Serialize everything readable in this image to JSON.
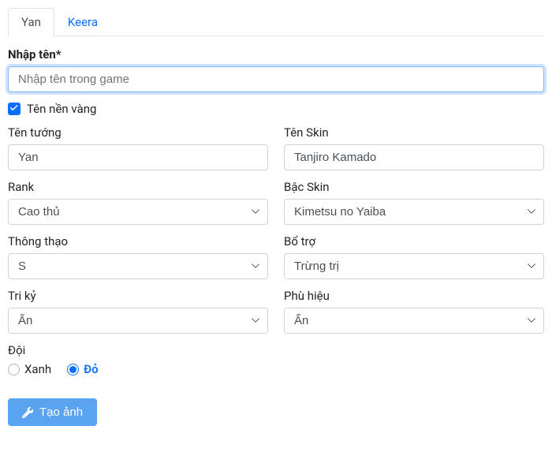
{
  "tabs": [
    {
      "label": "Yan",
      "active": true
    },
    {
      "label": "Keera",
      "active": false
    }
  ],
  "name_section": {
    "label": "Nhập tên*",
    "placeholder": "Nhập tên trong game",
    "value": ""
  },
  "gold_name": {
    "checked": true,
    "label": "Tên nền vàng"
  },
  "fields": {
    "champion": {
      "label": "Tên tướng",
      "value": "Yan"
    },
    "skin": {
      "label": "Tên Skin",
      "value": "Tanjiro Kamado"
    },
    "rank": {
      "label": "Rank",
      "value": "Cao thủ"
    },
    "skin_tier": {
      "label": "Bậc Skin",
      "value": "Kimetsu no Yaiba"
    },
    "mastery": {
      "label": "Thông thạo",
      "value": "S"
    },
    "support": {
      "label": "Bổ trợ",
      "value": "Trừng trị"
    },
    "companion": {
      "label": "Tri kỷ",
      "value": "Ẩn"
    },
    "badge": {
      "label": "Phù hiệu",
      "value": "Ẩn"
    }
  },
  "team": {
    "label": "Đội",
    "options": [
      {
        "label": "Xanh",
        "value": "blue",
        "checked": false
      },
      {
        "label": "Đỏ",
        "value": "red",
        "checked": true
      }
    ]
  },
  "submit": {
    "label": "Tạo ảnh"
  }
}
